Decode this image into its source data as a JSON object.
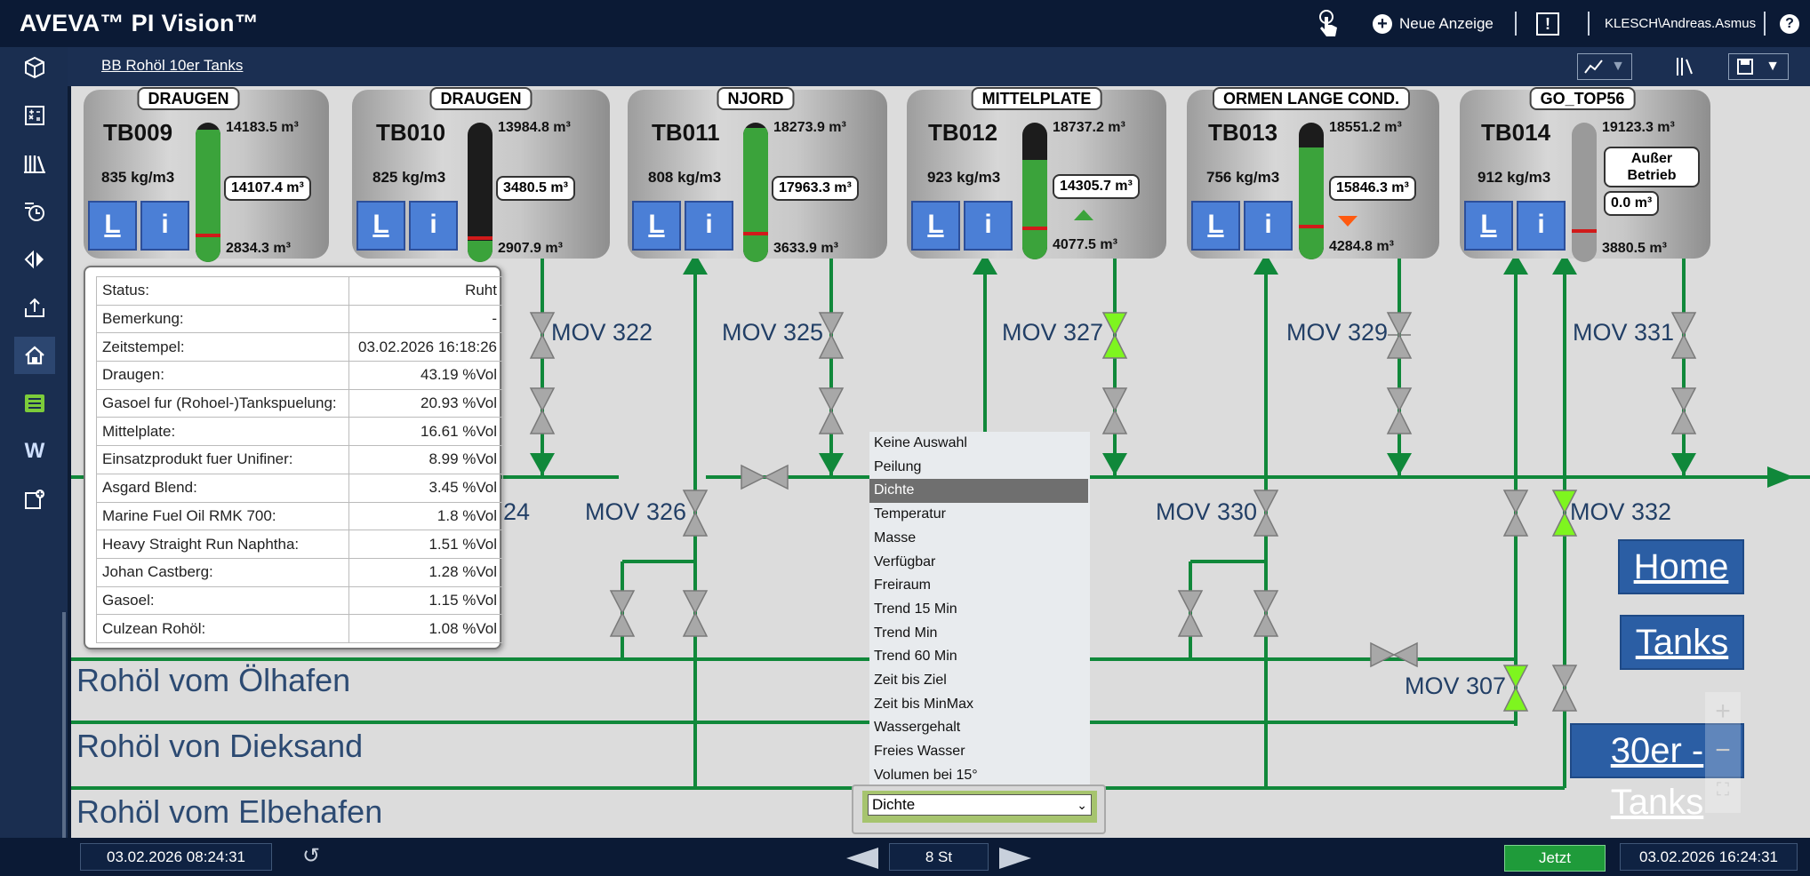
{
  "app": {
    "brand": "AVEVA™ PI Vision™",
    "new_display": "Neue Anzeige",
    "user": "KLESCH\\Andreas.Asmus",
    "help": "?",
    "excl": "!"
  },
  "subheader": {
    "breadcrumb": "BB Rohöl 10er Tanks"
  },
  "tanks": [
    {
      "id": "TB009",
      "source": "DRAUGEN",
      "density": "835 kg/m3",
      "max": "14183.5 m³",
      "current": "14107.4 m³",
      "min": "2834.3 m³",
      "level": 0.95,
      "trend": "none"
    },
    {
      "id": "TB010",
      "source": "DRAUGEN",
      "density": "825 kg/m3",
      "max": "13984.8 m³",
      "current": "3480.5 m³",
      "min": "2907.9 m³",
      "level": 0.15,
      "trend": "none"
    },
    {
      "id": "TB011",
      "source": "NJORD",
      "density": "808 kg/m3",
      "max": "18273.9 m³",
      "current": "17963.3 m³",
      "min": "3633.9 m³",
      "level": 0.96,
      "trend": "none"
    },
    {
      "id": "TB012",
      "source": "MITTELPLATE",
      "density": "923 kg/m3",
      "max": "18737.2 m³",
      "current": "14305.7 m³",
      "min": "4077.5 m³",
      "level": 0.73,
      "trend": "up"
    },
    {
      "id": "TB013",
      "source": "ORMEN LANGE COND.",
      "density": "756 kg/m3",
      "max": "18551.2 m³",
      "current": "15846.3 m³",
      "min": "4284.8 m³",
      "level": 0.82,
      "trend": "down"
    },
    {
      "id": "TB014",
      "source": "GO_TOP56",
      "density": "912 kg/m3",
      "max": "19123.3 m³",
      "current": "0.0 m³",
      "min": "3880.5 m³",
      "level": 0.0,
      "trend": "none",
      "status": "Außer Betrieb"
    }
  ],
  "buttons": {
    "l": "L",
    "i": "i"
  },
  "valves": {
    "mov322": "MOV 322",
    "mov325": "MOV 325",
    "mov327": "MOV 327",
    "mov329": "MOV 329",
    "mov331": "MOV 331",
    "mov326": "MOV 326",
    "mov330": "MOV 330",
    "mov332": "MOV 332",
    "mov307": "MOV 307",
    "partial24": "24"
  },
  "pipelines": {
    "oelhafen": "Rohöl vom Ölhafen",
    "dieksand": "Rohöl von Dieksand",
    "elbehafen": "Rohöl vom Elbehafen"
  },
  "nav": {
    "home": "Home",
    "tanks": "Tanks",
    "tanks30": "30er -Tanks"
  },
  "info_table": [
    {
      "label": "Status:",
      "value": "Ruht"
    },
    {
      "label": "Bemerkung:",
      "value": "-"
    },
    {
      "label": "Zeitstempel:",
      "value": "03.02.2026 16:18:26"
    },
    {
      "label": "Draugen:",
      "value": "43.19 %Vol"
    },
    {
      "label": "Gasoel fur (Rohoel-)Tankspuelung:",
      "value": "20.93 %Vol"
    },
    {
      "label": "Mittelplate:",
      "value": "16.61 %Vol"
    },
    {
      "label": "Einsatzprodukt fuer Unifiner:",
      "value": "8.99 %Vol"
    },
    {
      "label": "Asgard Blend:",
      "value": "3.45 %Vol"
    },
    {
      "label": "Marine Fuel Oil RMK 700:",
      "value": "1.8 %Vol"
    },
    {
      "label": "Heavy Straight Run Naphtha:",
      "value": "1.51 %Vol"
    },
    {
      "label": "Johan Castberg:",
      "value": "1.28 %Vol"
    },
    {
      "label": "Gasoel:",
      "value": "1.15 %Vol"
    },
    {
      "label": "Culzean Rohöl:",
      "value": "1.08 %Vol"
    }
  ],
  "dropdown": {
    "options": [
      "Keine Auswahl",
      "Peilung",
      "Dichte",
      "Temperatur",
      "Masse",
      "Verfügbar",
      "Freiraum",
      "Trend 15 Min",
      "Trend Min",
      "Trend 60 Min",
      "Zeit bis Ziel",
      "Zeit bis MinMax",
      "Wassergehalt",
      "Freies Wasser",
      "Volumen bei 15°"
    ],
    "selected": "Dichte"
  },
  "bottom": {
    "start": "03.02.2026 08:24:31",
    "duration": "8 St",
    "now_button": "Jetzt",
    "end": "03.02.2026 16:24:31"
  },
  "colors": {
    "pipe": "#10883a",
    "valve_open": "#7ef51f",
    "valve_closed": "#a8a8a8",
    "level": "#3ba33b",
    "button_blue": "#4b7fd6"
  }
}
